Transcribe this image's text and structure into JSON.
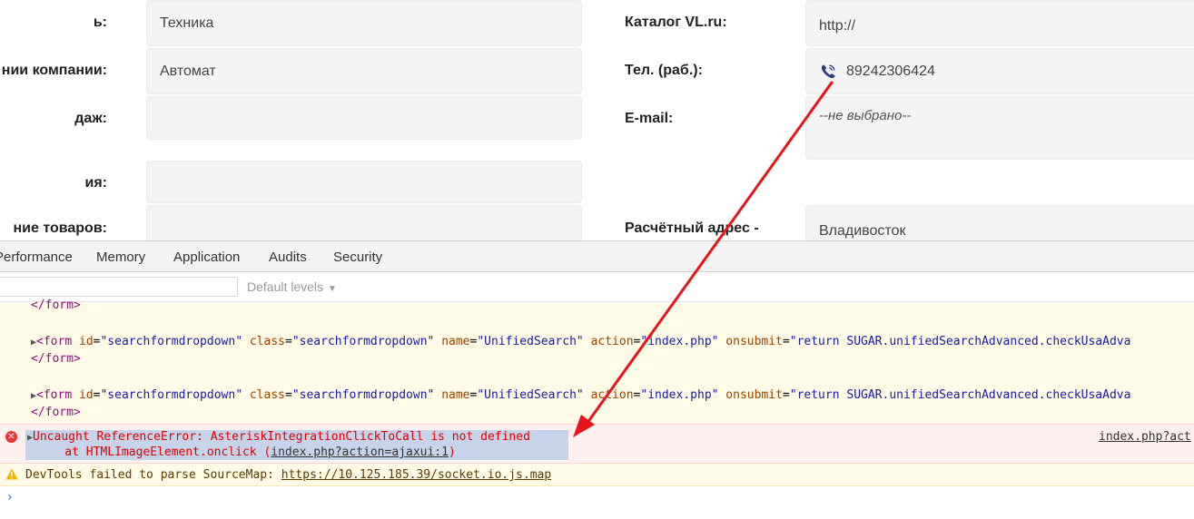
{
  "form": {
    "left_labels": [
      "ь:",
      "нии компании:",
      "дaж:",
      "ия:",
      "ние товаров:"
    ],
    "left_fields": [
      "Техника",
      "Автомат",
      "",
      "",
      ""
    ],
    "right_labels": [
      "Каталог VL.ru:",
      "Тел. (раб.):",
      "E-mail:",
      "Расчётный адрес -"
    ],
    "catalog_value": "http://",
    "phone_value": "89242306424",
    "email_value": "--не выбрано--",
    "address_value": "Владивосток"
  },
  "devtools": {
    "tabs": [
      "Performance",
      "Memory",
      "Application",
      "Audits",
      "Security"
    ],
    "filter_placeholder": "",
    "levels_label": "Default levels",
    "lines": {
      "close_form_1": "</form>",
      "form_2_open": "<form",
      "form_2_attrs": [
        {
          "name": "id",
          "value": "\"searchformdropdown\""
        },
        {
          "name": "class",
          "value": "\"searchformdropdown\""
        },
        {
          "name": "name",
          "value": "\"UnifiedSearch\""
        },
        {
          "name": "action",
          "value": "\"index.php\""
        },
        {
          "name": "onsubmit",
          "value": "\"return SUGAR.unifiedSearchAdvanced.checkUsaAdva"
        }
      ],
      "close_form_2": "</form>",
      "close_form_3": "</form>"
    },
    "error": {
      "message": "Uncaught ReferenceError: AsteriskIntegrationClickToCall is not defined",
      "stack_prefix": "    at HTMLImageElement.onclick (",
      "stack_link": "index.php?action=ajaxui:1",
      "stack_suffix": ")",
      "source_link": "index.php?act"
    },
    "warning": {
      "message": "DevTools failed to parse SourceMap: ",
      "link": "https://10.125.185.39/socket.io.js.map"
    },
    "prompt_symbol": "›"
  },
  "colors": {
    "arrow": "#e8141b",
    "error_text": "#e00000",
    "selection": "#c6d3ea",
    "warning_bg": "#fffbe6"
  }
}
